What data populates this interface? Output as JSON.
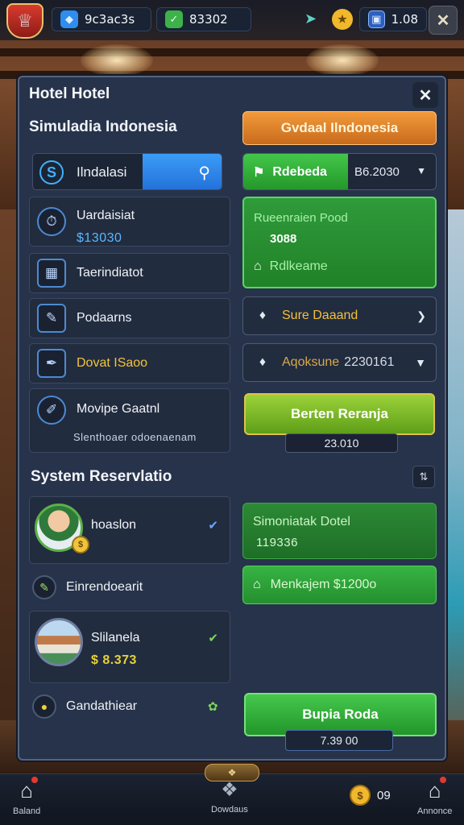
{
  "hud": {
    "gems_value": "9c3ac3s",
    "cash_value": "83302",
    "ticket_value": "1.08",
    "gems_icon": "blue-gem-icon",
    "cash_icon": "green-cash-icon",
    "close_icon": "close-icon"
  },
  "panel": {
    "title": "Hotel Hotel",
    "subtitle": "Simuladia Indonesia",
    "orange_button": "Gvdaal Ilndonesia",
    "search": {
      "value": "Ilndalasi"
    },
    "combo": {
      "label": "Rdebeda",
      "value": "B6.2030"
    },
    "left_items": [
      {
        "label": "Uardaisiat",
        "sub": "$13030",
        "icon": "timer-icon"
      },
      {
        "label": "Taerindiatot",
        "icon": "grid-icon"
      },
      {
        "label": "Podaarns",
        "icon": "pencil-icon"
      },
      {
        "label": "Dovat ISaoo",
        "icon": "pen-icon"
      },
      {
        "label": "Movipe Gaatnl",
        "sub": "Slenthoaer odoenaenam",
        "icon": "brush-icon"
      }
    ],
    "green_box": {
      "title": "Rueenraien Pood",
      "value": "3088",
      "footer": "Rdlkeame"
    },
    "row_sure": {
      "label": "Sure Daaand"
    },
    "row_apo": {
      "label": "Aqoksune",
      "value": "2230161"
    },
    "lime_button": "Berten Reranja",
    "lime_tag": "23.010",
    "section_title": "System Reservlatio",
    "reservations": [
      {
        "name": "hoaslon"
      },
      {
        "name": "Slilanela",
        "value": "$ 8.373"
      }
    ],
    "plain_rows": [
      {
        "label": "Einrendoearit"
      },
      {
        "label": "Gandathiear"
      }
    ],
    "green_card": {
      "title": "Simoniatak Dotel",
      "value": "119336"
    },
    "green_row": {
      "label": "Menkajem $1200o"
    },
    "big_green_button": "Bupia Roda",
    "big_green_tag": "7.39 00"
  },
  "bottom_nav": {
    "left_label": "Baland",
    "center_label": "Dowdaus",
    "coin_value": "09",
    "right_label": "Annonce"
  },
  "colors": {
    "panel_bg": "#27334a",
    "accent_green": "#2f9b3a",
    "accent_orange": "#e08a2e",
    "accent_blue": "#2f86ea"
  }
}
